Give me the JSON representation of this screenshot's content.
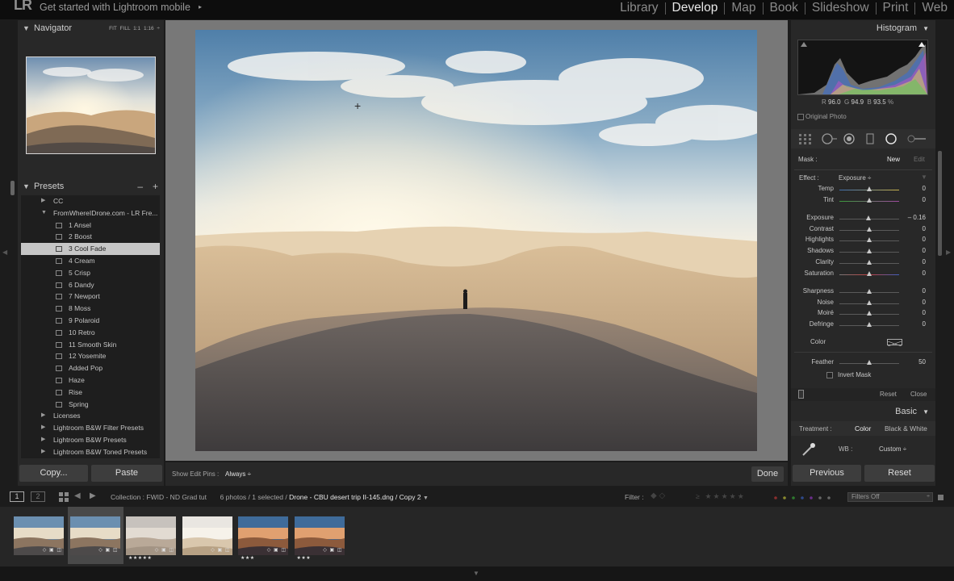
{
  "topbar": {
    "logo": "LR",
    "mobile_text": "Get started with Lightroom mobile",
    "mobile_arrow": "▸",
    "modules": [
      "Library",
      "Develop",
      "Map",
      "Book",
      "Slideshow",
      "Print",
      "Web"
    ],
    "active_module": "Develop"
  },
  "navigator": {
    "title": "Navigator",
    "options": "FIT   FILL   1:1   1:16 ÷"
  },
  "presets": {
    "title": "Presets",
    "minus": "–",
    "plus": "+",
    "items": [
      {
        "type": "folder",
        "label": "CC",
        "open": false
      },
      {
        "type": "folder",
        "label": "FromWhereIDrone.com - LR Fre...",
        "open": true
      },
      {
        "type": "preset",
        "label": "1 Ansel"
      },
      {
        "type": "preset",
        "label": "2 Boost"
      },
      {
        "type": "preset",
        "label": "3 Cool Fade",
        "selected": true
      },
      {
        "type": "preset",
        "label": "4 Cream"
      },
      {
        "type": "preset",
        "label": "5 Crisp"
      },
      {
        "type": "preset",
        "label": "6 Dandy"
      },
      {
        "type": "preset",
        "label": "7 Newport"
      },
      {
        "type": "preset",
        "label": "8 Moss"
      },
      {
        "type": "preset",
        "label": "9 Polaroid"
      },
      {
        "type": "preset",
        "label": "10 Retro"
      },
      {
        "type": "preset",
        "label": "11 Smooth Skin"
      },
      {
        "type": "preset",
        "label": "12 Yosemite"
      },
      {
        "type": "preset",
        "label": "Added Pop"
      },
      {
        "type": "preset",
        "label": "Haze"
      },
      {
        "type": "preset",
        "label": "Rise"
      },
      {
        "type": "preset",
        "label": "Spring"
      },
      {
        "type": "folder",
        "label": "Licenses",
        "open": false
      },
      {
        "type": "folder",
        "label": "Lightroom B&W Filter Presets",
        "open": false
      },
      {
        "type": "folder",
        "label": "Lightroom B&W Presets",
        "open": false
      },
      {
        "type": "folder",
        "label": "Lightroom B&W Toned Presets",
        "open": false
      }
    ]
  },
  "left_buttons": {
    "copy": "Copy...",
    "paste": "Paste"
  },
  "center_toolbar": {
    "edit_pins_label": "Show Edit Pins :",
    "edit_pins_value": "Always ÷",
    "done": "Done"
  },
  "histogram": {
    "title": "Histogram",
    "r_label": "R",
    "r_value": "96.0",
    "g_label": "G",
    "g_value": "94.9",
    "b_label": "B",
    "b_value": "93.5",
    "unit": "%",
    "original_photo": "Original Photo"
  },
  "mask": {
    "label": "Mask :",
    "new": "New",
    "edit": "Edit",
    "effect_label": "Effect :",
    "effect_value": "Exposure ÷",
    "sliders_a": [
      {
        "label": "Temp",
        "value": "0",
        "pos": 0.5
      },
      {
        "label": "Tint",
        "value": "0",
        "pos": 0.5
      }
    ],
    "sliders_b": [
      {
        "label": "Exposure",
        "value": "– 0.16",
        "pos": 0.49
      },
      {
        "label": "Contrast",
        "value": "0",
        "pos": 0.5
      },
      {
        "label": "Highlights",
        "value": "0",
        "pos": 0.5
      },
      {
        "label": "Shadows",
        "value": "0",
        "pos": 0.5
      },
      {
        "label": "Clarity",
        "value": "0",
        "pos": 0.5
      },
      {
        "label": "Saturation",
        "value": "0",
        "pos": 0.5
      }
    ],
    "sliders_c": [
      {
        "label": "Sharpness",
        "value": "0",
        "pos": 0.5
      },
      {
        "label": "Noise",
        "value": "0",
        "pos": 0.5
      },
      {
        "label": "Moiré",
        "value": "0",
        "pos": 0.5
      },
      {
        "label": "Defringe",
        "value": "0",
        "pos": 0.5
      }
    ],
    "color_label": "Color",
    "feather_label": "Feather",
    "feather_value": "50",
    "feather_pos": 0.5,
    "invert_mask": "Invert Mask",
    "reset": "Reset",
    "close": "Close"
  },
  "basic": {
    "title": "Basic",
    "treatment_label": "Treatment :",
    "color": "Color",
    "bw": "Black & White",
    "wb_label": "WB :",
    "wb_value": "Custom ÷"
  },
  "right_buttons": {
    "previous": "Previous",
    "reset": "Reset"
  },
  "filmbar": {
    "view1": "1",
    "view2": "2",
    "collection": "Collection : FWID - ND Grad tut",
    "count": "6 photos / 1 selected /",
    "filename": "Drone - CBU desert trip II-145.dng / Copy 2",
    "filter_label": "Filter :",
    "filters_off": "Filters Off"
  },
  "filmstrip": [
    {
      "stars": "",
      "selected": false,
      "style": "dusk"
    },
    {
      "stars": "",
      "selected": true,
      "style": "dusk"
    },
    {
      "stars": "★★★★★",
      "selected": false,
      "style": "fade"
    },
    {
      "stars": "",
      "selected": false,
      "style": "bright"
    },
    {
      "stars": "★★★",
      "selected": false,
      "style": "sunset"
    },
    {
      "stars": "★★★",
      "selected": false,
      "style": "sunset"
    }
  ]
}
